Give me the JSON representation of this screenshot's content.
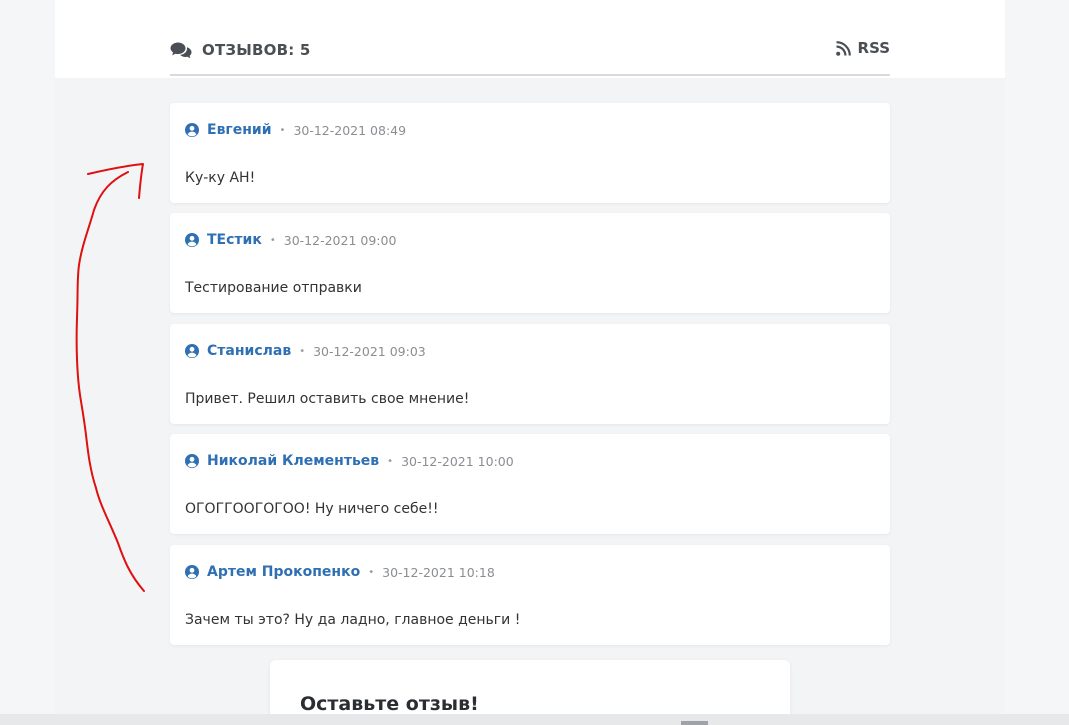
{
  "comments_section": {
    "title": "ОТЗЫВОВ: 5",
    "rss_label": "RSS",
    "icons": {
      "title_icon": "comments-icon",
      "rss_icon": "rss-icon",
      "author_icon": "user-circle-icon"
    },
    "colors": {
      "author": "#2f6fb3",
      "annotation": "#e01010"
    },
    "comments": [
      {
        "author": "Евгений",
        "separator": "•",
        "date": "30-12-2021 08:49",
        "text": "Ку-ку АН!"
      },
      {
        "author": "ТЕстик",
        "separator": "•",
        "date": "30-12-2021 09:00",
        "text": "Тестирование отправки"
      },
      {
        "author": "Станислав",
        "separator": "•",
        "date": "30-12-2021 09:03",
        "text": "Привет. Решил оставить свое мнение!"
      },
      {
        "author": "Николай Клементьев",
        "separator": "•",
        "date": "30-12-2021 10:00",
        "text": "ОГОГГООГОГОО! Ну ничего себе!!"
      },
      {
        "author": "Артем Прокопенко",
        "separator": "•",
        "date": "30-12-2021 10:18",
        "text": "Зачем ты это? Ну да ладно, главное деньги !"
      }
    ]
  },
  "review_form": {
    "title": "Оставьте отзыв!"
  }
}
